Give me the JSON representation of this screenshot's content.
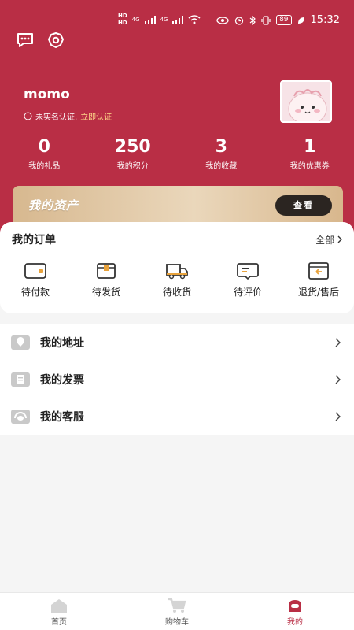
{
  "status_bar": {
    "hd1": "HD",
    "hd2": "HD",
    "net1": "4G",
    "net2": "4G",
    "battery": "89",
    "time": "15:32"
  },
  "top_icons": [
    "chat-icon",
    "settings-icon"
  ],
  "user": {
    "name": "momo",
    "verify_text": "未实名认证,",
    "verify_link": "立即认证"
  },
  "stats": [
    {
      "value": "0",
      "label": "我的礼品"
    },
    {
      "value": "250",
      "label": "我的积分"
    },
    {
      "value": "3",
      "label": "我的收藏"
    },
    {
      "value": "1",
      "label": "我的优惠券"
    }
  ],
  "assets": {
    "title": "我的资产",
    "button": "查看"
  },
  "orders": {
    "title": "我的订单",
    "all": "全部",
    "items": [
      {
        "label": "待付款",
        "icon": "wallet-icon"
      },
      {
        "label": "待发货",
        "icon": "box-icon"
      },
      {
        "label": "待收货",
        "icon": "truck-icon"
      },
      {
        "label": "待评价",
        "icon": "comment-icon"
      },
      {
        "label": "退货/售后",
        "icon": "return-icon"
      }
    ]
  },
  "menu": [
    {
      "label": "我的地址",
      "icon": "location-icon"
    },
    {
      "label": "我的发票",
      "icon": "invoice-icon"
    },
    {
      "label": "我的客服",
      "icon": "customer-service-icon"
    }
  ],
  "tabbar": [
    {
      "label": "首页",
      "icon": "home-icon"
    },
    {
      "label": "购物车",
      "icon": "cart-icon"
    },
    {
      "label": "我的",
      "icon": "profile-icon"
    }
  ],
  "colors": {
    "brand": "#b92e45",
    "asset_gold": "#d7b88f",
    "button_dark": "#2b2521"
  }
}
